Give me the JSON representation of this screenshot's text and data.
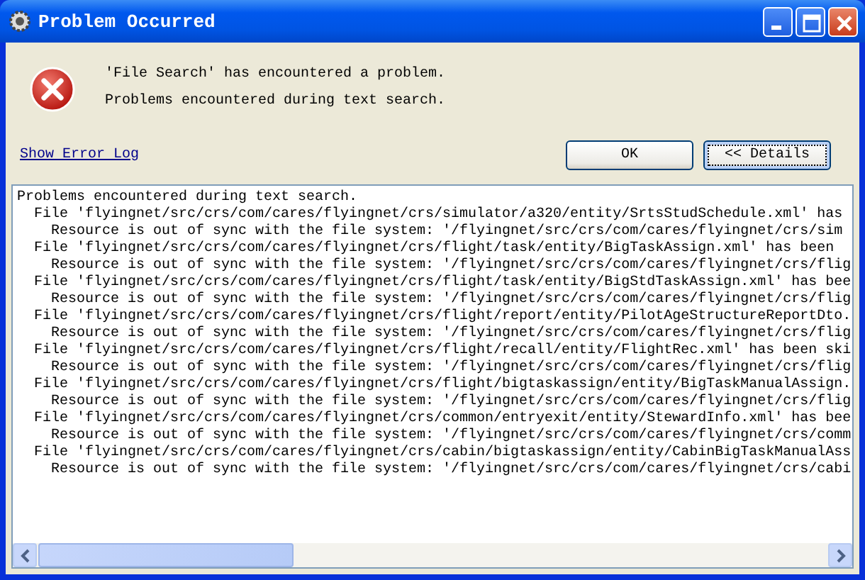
{
  "window": {
    "title": "Problem Occurred"
  },
  "message": {
    "heading": "'File Search' has encountered a problem.",
    "detail": "Problems encountered during text search."
  },
  "link": "Show Error Log",
  "buttons": [
    {
      "label": "OK",
      "focused": false
    },
    {
      "label": "<< Details",
      "focused": true
    }
  ],
  "details": [
    {
      "text": "Problems encountered during text search.",
      "children": [
        {
          "text": "File 'flyingnet/src/crs/com/cares/flyingnet/crs/simulator/a320/entity/SrtsStudSchedule.xml' has",
          "children": [
            {
              "text": "Resource is out of sync with the file system: '/flyingnet/src/crs/com/cares/flyingnet/crs/sim"
            }
          ]
        },
        {
          "text": "File 'flyingnet/src/crs/com/cares/flyingnet/crs/flight/task/entity/BigTaskAssign.xml' has been",
          "children": [
            {
              "text": "Resource is out of sync with the file system: '/flyingnet/src/crs/com/cares/flyingnet/crs/flig"
            }
          ]
        },
        {
          "text": "File 'flyingnet/src/crs/com/cares/flyingnet/crs/flight/task/entity/BigStdTaskAssign.xml' has bee",
          "children": [
            {
              "text": "Resource is out of sync with the file system: '/flyingnet/src/crs/com/cares/flyingnet/crs/flig"
            }
          ]
        },
        {
          "text": "File 'flyingnet/src/crs/com/cares/flyingnet/crs/flight/report/entity/PilotAgeStructureReportDto.",
          "children": [
            {
              "text": "Resource is out of sync with the file system: '/flyingnet/src/crs/com/cares/flyingnet/crs/flig"
            }
          ]
        },
        {
          "text": "File 'flyingnet/src/crs/com/cares/flyingnet/crs/flight/recall/entity/FlightRec.xml' has been ski",
          "children": [
            {
              "text": "Resource is out of sync with the file system: '/flyingnet/src/crs/com/cares/flyingnet/crs/flig"
            }
          ]
        },
        {
          "text": "File 'flyingnet/src/crs/com/cares/flyingnet/crs/flight/bigtaskassign/entity/BigTaskManualAssign.",
          "children": [
            {
              "text": "Resource is out of sync with the file system: '/flyingnet/src/crs/com/cares/flyingnet/crs/flig"
            }
          ]
        },
        {
          "text": "File 'flyingnet/src/crs/com/cares/flyingnet/crs/common/entryexit/entity/StewardInfo.xml' has bee",
          "children": [
            {
              "text": "Resource is out of sync with the file system: '/flyingnet/src/crs/com/cares/flyingnet/crs/comm"
            }
          ]
        },
        {
          "text": "File 'flyingnet/src/crs/com/cares/flyingnet/crs/cabin/bigtaskassign/entity/CabinBigTaskManualAss",
          "children": [
            {
              "text": "Resource is out of sync with the file system: '/flyingnet/src/crs/com/cares/flyingnet/crs/cabi"
            }
          ]
        }
      ]
    }
  ]
}
